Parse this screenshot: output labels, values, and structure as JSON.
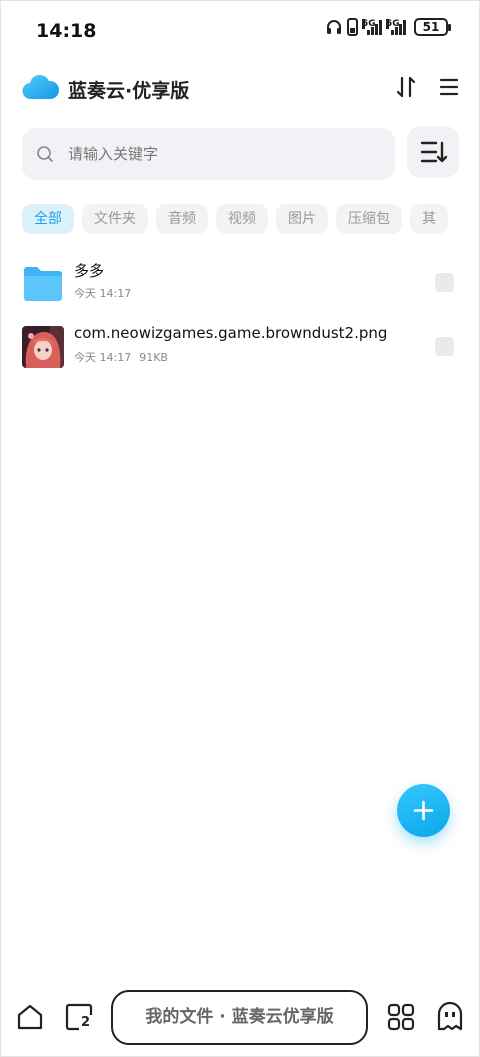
{
  "status_bar": {
    "time": "14:18",
    "network_1": "5G",
    "network_2": "5G",
    "battery": "51",
    "icons": [
      "headphones-icon",
      "phone-icon",
      "signal-icon",
      "signal-icon",
      "battery-icon"
    ]
  },
  "header": {
    "title": "蓝奏云·优享版",
    "logo_icon": "cloud-icon",
    "actions": [
      "sort-icon",
      "menu-icon"
    ]
  },
  "search": {
    "placeholder": "请输入关键字",
    "value": "",
    "icon": "search-icon",
    "view_icon": "list-sort-icon"
  },
  "filters": {
    "items": [
      "全部",
      "文件夹",
      "音频",
      "视频",
      "图片",
      "压缩包",
      "其"
    ],
    "selected": "全部"
  },
  "files": [
    {
      "name": "多多",
      "date": "今天 14:17",
      "size": "",
      "type": "folder"
    },
    {
      "name": "com.neowizgames.game.browndust2.png",
      "date": "今天 14:17",
      "size": "91KB",
      "type": "image"
    }
  ],
  "fab": {
    "icon": "plus-icon"
  },
  "bottom_bar": {
    "address": "我的文件 · 蓝奏云优享版",
    "tab_count": "2",
    "icons": [
      "home-icon",
      "tabs-icon",
      "apps-icon",
      "ghost-icon"
    ]
  },
  "colors": {
    "accent": "#1aa3e8",
    "chip_active_bg": "#ddf1fb",
    "chip_bg": "#f2f3f5",
    "search_bg": "#f1f2f5",
    "folder": "#3cb4f5"
  }
}
